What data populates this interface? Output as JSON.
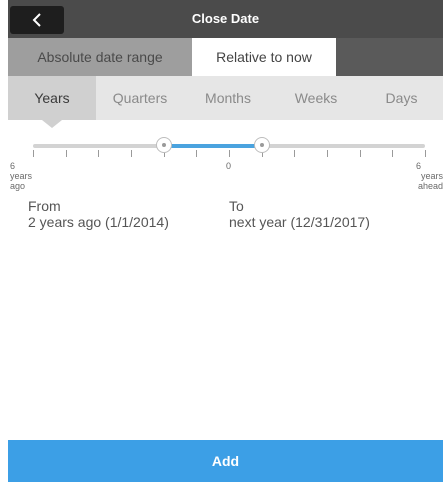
{
  "header": {
    "title": "Close Date",
    "back_icon": "chevron-left-icon"
  },
  "mode_tabs": [
    {
      "label": "Absolute date range",
      "selected": false
    },
    {
      "label": "Relative to now",
      "selected": true
    }
  ],
  "unit_tabs": [
    {
      "label": "Years",
      "selected": true
    },
    {
      "label": "Quarters",
      "selected": false
    },
    {
      "label": "Months",
      "selected": false
    },
    {
      "label": "Weeks",
      "selected": false
    },
    {
      "label": "Days",
      "selected": false
    }
  ],
  "slider": {
    "min": -6,
    "max": 6,
    "from_value": -2,
    "to_value": 1,
    "min_label": [
      "6",
      "years",
      "ago"
    ],
    "zero_label": "0",
    "max_label": [
      "6",
      "years",
      "ahead"
    ],
    "fill_color": "#4aa3df"
  },
  "range": {
    "from_title": "From",
    "from_value": "2 years ago (1/1/2014)",
    "to_title": "To",
    "to_value": "next year (12/31/2017)"
  },
  "add_button": {
    "label": "Add",
    "color": "#3c9fe6"
  }
}
